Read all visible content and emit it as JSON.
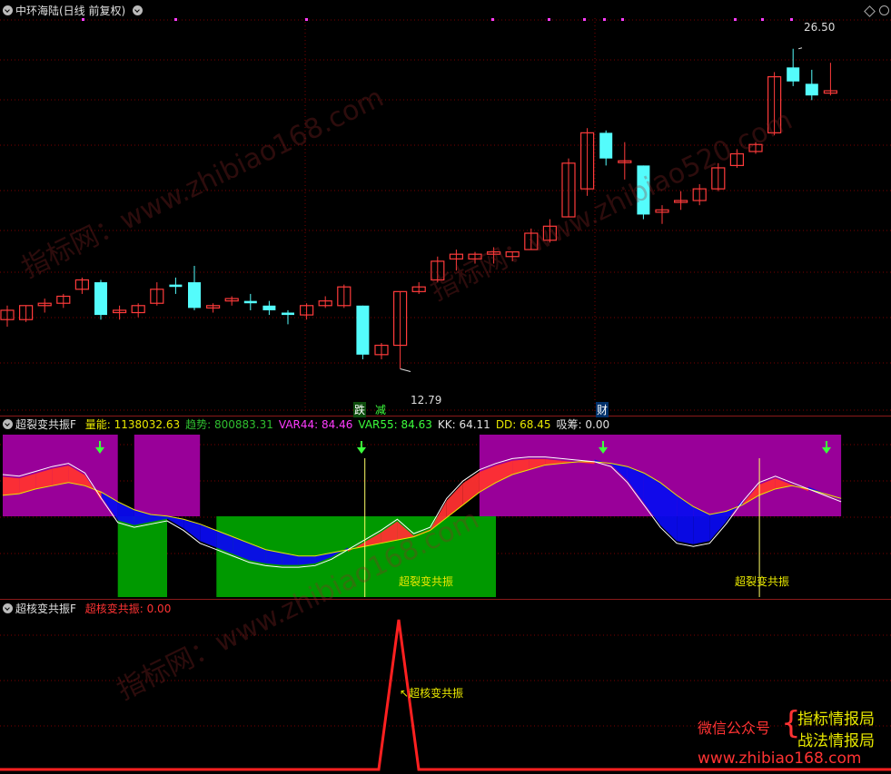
{
  "panel1": {
    "title": "中环海陆(日线 前复权)",
    "max_label": "26.50",
    "min_label": "12.79",
    "tags": [
      "跌",
      "减",
      "财"
    ]
  },
  "panel2": {
    "name": "超裂变共振F",
    "fields": [
      {
        "label": "量能:",
        "value": "1138032.63",
        "color": "#e8e800"
      },
      {
        "label": "趋势:",
        "value": "800883.31",
        "color": "#2fbf2f"
      },
      {
        "label": "VAR44:",
        "value": "84.46",
        "color": "#ff3cff"
      },
      {
        "label": "VAR55:",
        "value": "84.63",
        "color": "#3cff3c"
      },
      {
        "label": "KK:",
        "value": "64.11",
        "color": "#e0e0e0"
      },
      {
        "label": "DD:",
        "value": "68.45",
        "color": "#e8e800"
      },
      {
        "label": "吸筹:",
        "value": "0.00",
        "color": "#e0e0e0"
      }
    ],
    "signal_label_1": "超裂变共振",
    "signal_label_2": "超裂变共振"
  },
  "panel3": {
    "name": "超核变共振F",
    "field_label": "超核变共振:",
    "field_value": "0.00",
    "peak_label": "超核变共振"
  },
  "promo": {
    "left": "微信公众号",
    "right1": "指标情报局",
    "right2": "战法情报局",
    "url": "www.zhibiao168.com"
  },
  "watermarks": [
    "指标网：www.zhibiao168.com",
    "指标网：www.zhibiao520.com",
    "指标网：www.zhibiao168.com"
  ],
  "colors": {
    "up": "#ff3b3b",
    "down": "#54fcfc",
    "purple": "#990099",
    "green": "#009900",
    "grid": "#7a0000"
  },
  "chart_data": [
    {
      "type": "candlestick",
      "title": "中环海陆(日线 前复权)",
      "ylim": [
        11.8,
        27.5
      ],
      "candles": [
        [
          14.9,
          15.5,
          14.6,
          15.3
        ],
        [
          14.9,
          15.5,
          14.8,
          15.5
        ],
        [
          15.5,
          15.8,
          15.2,
          15.6
        ],
        [
          15.6,
          16.0,
          15.4,
          15.9
        ],
        [
          16.2,
          16.7,
          16.0,
          16.6
        ],
        [
          16.5,
          16.6,
          14.9,
          15.1
        ],
        [
          15.2,
          15.5,
          14.9,
          15.3
        ],
        [
          15.2,
          15.6,
          15.0,
          15.5
        ],
        [
          15.6,
          16.5,
          15.5,
          16.2
        ],
        [
          16.4,
          16.7,
          16.0,
          16.3
        ],
        [
          16.5,
          17.2,
          15.3,
          15.4
        ],
        [
          15.4,
          15.6,
          15.2,
          15.5
        ],
        [
          15.7,
          15.9,
          15.5,
          15.8
        ],
        [
          15.7,
          16.0,
          15.3,
          15.6
        ],
        [
          15.5,
          15.7,
          15.1,
          15.3
        ],
        [
          15.2,
          15.3,
          14.7,
          15.1
        ],
        [
          15.1,
          15.6,
          14.9,
          15.5
        ],
        [
          15.5,
          15.9,
          15.4,
          15.7
        ],
        [
          15.5,
          16.4,
          15.4,
          16.3
        ],
        [
          15.5,
          15.5,
          13.2,
          13.4
        ],
        [
          13.4,
          13.9,
          13.2,
          13.8
        ],
        [
          13.8,
          16.1,
          12.8,
          16.1
        ],
        [
          16.1,
          16.5,
          16.0,
          16.3
        ],
        [
          16.6,
          17.6,
          16.5,
          17.4
        ],
        [
          17.5,
          17.9,
          17.0,
          17.7
        ],
        [
          17.5,
          17.8,
          17.3,
          17.7
        ],
        [
          17.7,
          18.0,
          17.3,
          17.8
        ],
        [
          17.6,
          17.8,
          17.4,
          17.8
        ],
        [
          17.9,
          18.8,
          17.9,
          18.6
        ],
        [
          18.3,
          19.2,
          18.2,
          18.9
        ],
        [
          19.3,
          21.8,
          19.3,
          21.6
        ],
        [
          20.5,
          23.1,
          20.2,
          22.9
        ],
        [
          22.9,
          23.0,
          21.5,
          21.8
        ],
        [
          21.7,
          22.5,
          20.9,
          21.7
        ],
        [
          21.5,
          21.5,
          19.2,
          19.4
        ],
        [
          19.5,
          19.8,
          19.0,
          19.6
        ],
        [
          20.0,
          20.4,
          19.6,
          20.0
        ],
        [
          20.0,
          20.7,
          19.8,
          20.5
        ],
        [
          20.5,
          21.6,
          20.4,
          21.4
        ],
        [
          21.5,
          22.2,
          21.4,
          22.0
        ],
        [
          22.1,
          22.5,
          22.0,
          22.4
        ],
        [
          22.9,
          25.5,
          22.8,
          25.3
        ],
        [
          25.7,
          26.5,
          24.9,
          25.1
        ],
        [
          25.0,
          25.6,
          24.3,
          24.5
        ],
        [
          24.6,
          25.9,
          24.5,
          24.7
        ]
      ],
      "max": 26.5,
      "min": 12.79
    },
    {
      "type": "indicator",
      "title": "超裂变共振F",
      "white_line": [
        75,
        74,
        77,
        80,
        82,
        76,
        60,
        45,
        42,
        44,
        46,
        40,
        32,
        28,
        24,
        20,
        18,
        17,
        17,
        18,
        22,
        28,
        34,
        40,
        47,
        38,
        42,
        60,
        71,
        78,
        82,
        85,
        86,
        86,
        85,
        84,
        83,
        80,
        70,
        56,
        42,
        32,
        30,
        32,
        44,
        58,
        70,
        74,
        70,
        66,
        62,
        58
      ],
      "yellow_line": [
        62,
        63,
        66,
        68,
        70,
        68,
        64,
        58,
        53,
        50,
        49,
        47,
        44,
        40,
        36,
        32,
        28,
        26,
        24,
        24,
        26,
        28,
        30,
        32,
        34,
        36,
        40,
        48,
        56,
        64,
        70,
        75,
        78,
        81,
        82,
        83,
        83,
        82,
        80,
        76,
        70,
        62,
        55,
        50,
        52,
        56,
        62,
        66,
        68,
        66,
        63,
        60
      ],
      "purple_bands": [
        [
          0,
          7
        ],
        [
          8,
          12
        ],
        [
          29,
          51
        ]
      ],
      "green_bands": [
        [
          7,
          10
        ],
        [
          13,
          30
        ]
      ],
      "signals": [
        22,
        46
      ]
    },
    {
      "type": "line",
      "title": "超核变共振F",
      "peak_index": 21,
      "peak_value": 1
    }
  ]
}
